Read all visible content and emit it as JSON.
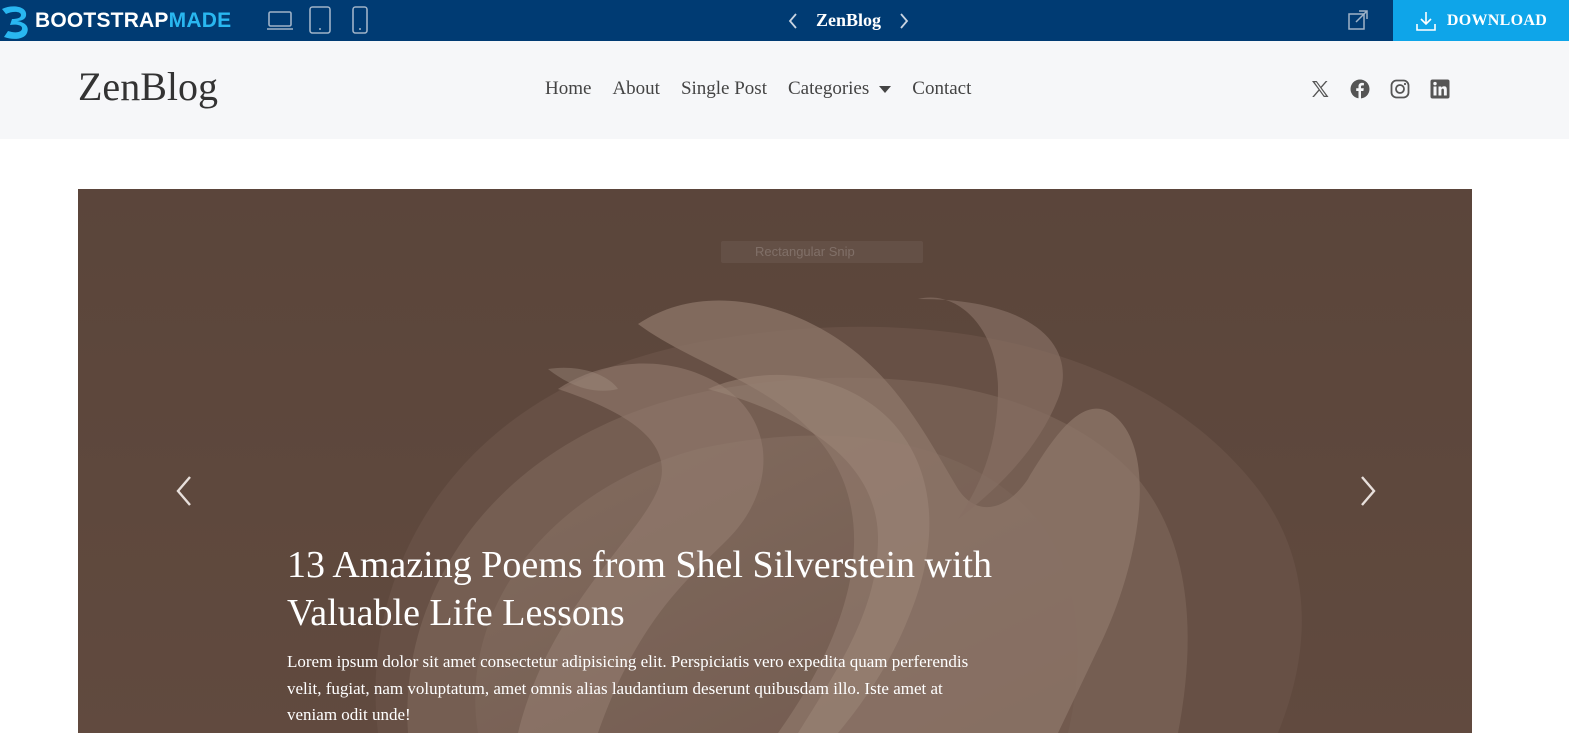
{
  "topbar": {
    "brand_part1": "BOOTSTRAP",
    "brand_part2": "MADE",
    "template_name": "ZenBlog",
    "download_label": "DOWNLOAD",
    "colors": {
      "background": "#003b73",
      "accent": "#29b7f0",
      "download": "#0ea5e9"
    }
  },
  "header": {
    "logo": "ZenBlog",
    "nav": [
      {
        "label": "Home"
      },
      {
        "label": "About"
      },
      {
        "label": "Single Post"
      },
      {
        "label": "Categories",
        "has_dropdown": true
      },
      {
        "label": "Contact"
      }
    ],
    "social_icons": [
      "x-icon",
      "facebook-icon",
      "instagram-icon",
      "linkedin-icon"
    ]
  },
  "hero": {
    "title": "13 Amazing Poems from Shel Silverstein with Valuable Life Lessons",
    "text": "Lorem ipsum dolor sit amet consectetur adipisicing elit. Perspiciatis vero expedita quam perferendis velit, fugiat, nam voluptatum, amet omnis alias laudantium deserunt quibusdam illo. Iste amet at veniam odit unde!",
    "overlay_label": "Rectangular Snip"
  }
}
